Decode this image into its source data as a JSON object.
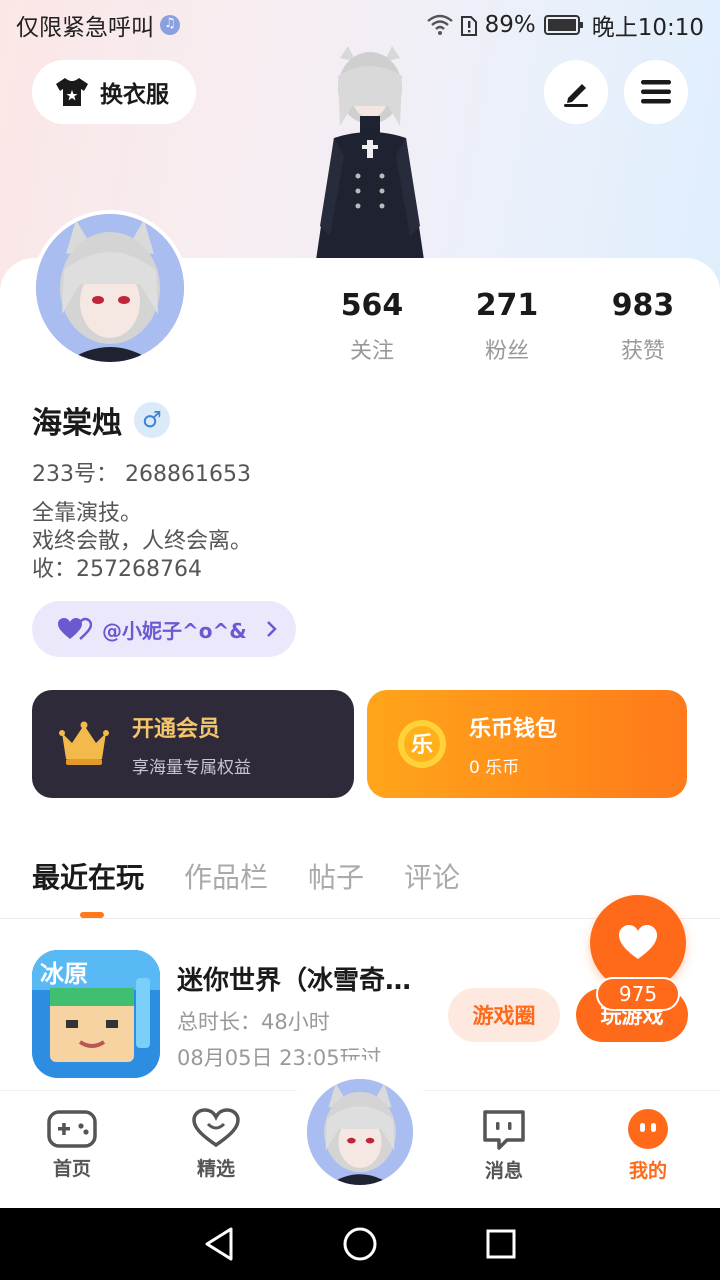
{
  "status_bar": {
    "carrier": "仅限紧急呼叫",
    "battery": "89%",
    "time": "晚上10:10"
  },
  "header": {
    "outfit_label": "换衣服",
    "edit_icon": "edit-pen-icon",
    "menu_icon": "menu-icon"
  },
  "profile": {
    "stats": [
      {
        "value": "564",
        "label": "关注"
      },
      {
        "value": "271",
        "label": "粉丝"
      },
      {
        "value": "983",
        "label": "获赞"
      }
    ],
    "name": "海棠烛",
    "gender": "♂",
    "uid": "233号： 268861653",
    "bio": [
      "全靠演技。",
      "戏终会散，人终会离。",
      "收：257268764"
    ],
    "couple_tag": "@小妮子^o^&"
  },
  "cards": {
    "vip": {
      "title": "开通会员",
      "subtitle": "享海量专属权益"
    },
    "wallet": {
      "title": "乐币钱包",
      "subtitle": "0 乐币",
      "coin_glyph": "乐"
    }
  },
  "tabs": [
    "最近在玩",
    "作品栏",
    "帖子",
    "评论"
  ],
  "recent_game": {
    "icon_text": "冰原",
    "title": "迷你世界（冰雪奇缘版）",
    "duration": "总时长：48小时",
    "last_played": "08月05日 23:05玩过",
    "circle_label": "游戏圈",
    "play_label": "玩游戏"
  },
  "fab": {
    "count": "975"
  },
  "bottom_nav": [
    {
      "label": "首页"
    },
    {
      "label": "精选"
    },
    {
      "label": "消息"
    },
    {
      "label": "我的"
    }
  ],
  "colors": {
    "accent": "#ff6a1a",
    "vip_bg": "#2e2a3a",
    "gold": "#f5c56b"
  }
}
